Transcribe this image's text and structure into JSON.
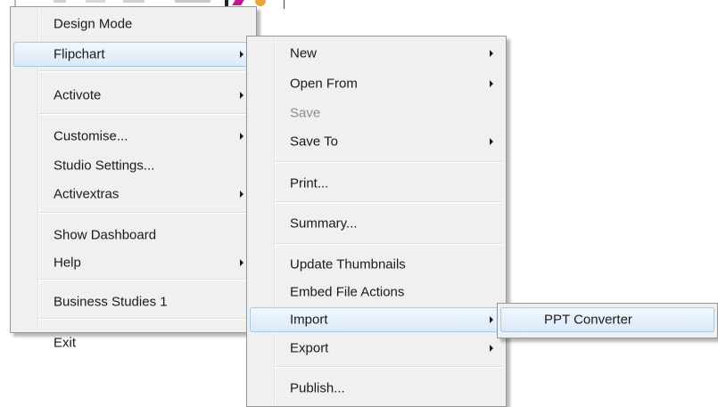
{
  "main_menu": {
    "items": [
      {
        "label": "Design Mode"
      },
      {
        "label": "Flipchart"
      },
      {
        "label": "Activote"
      },
      {
        "label": "Customise..."
      },
      {
        "label": "Studio Settings..."
      },
      {
        "label": "Activextras"
      },
      {
        "label": "Show Dashboard"
      },
      {
        "label": "Help"
      },
      {
        "label": "Business Studies 1"
      },
      {
        "label": "Exit"
      }
    ]
  },
  "flipchart_menu": {
    "items": [
      {
        "label": "New"
      },
      {
        "label": "Open From"
      },
      {
        "label": "Save"
      },
      {
        "label": "Save To"
      },
      {
        "label": "Print..."
      },
      {
        "label": "Summary..."
      },
      {
        "label": "Update Thumbnails"
      },
      {
        "label": "Embed File Actions"
      },
      {
        "label": "Import"
      },
      {
        "label": "Export"
      },
      {
        "label": "Publish..."
      }
    ]
  },
  "import_menu": {
    "items": [
      {
        "label": "PPT Converter"
      }
    ]
  },
  "colors": {
    "menu_bg": "#f0f0f0",
    "menu_border": "#979797",
    "highlight_border": "#a9c8e8",
    "highlight_bg": "#dbe9f8",
    "disabled_text": "#8d8d8d"
  }
}
